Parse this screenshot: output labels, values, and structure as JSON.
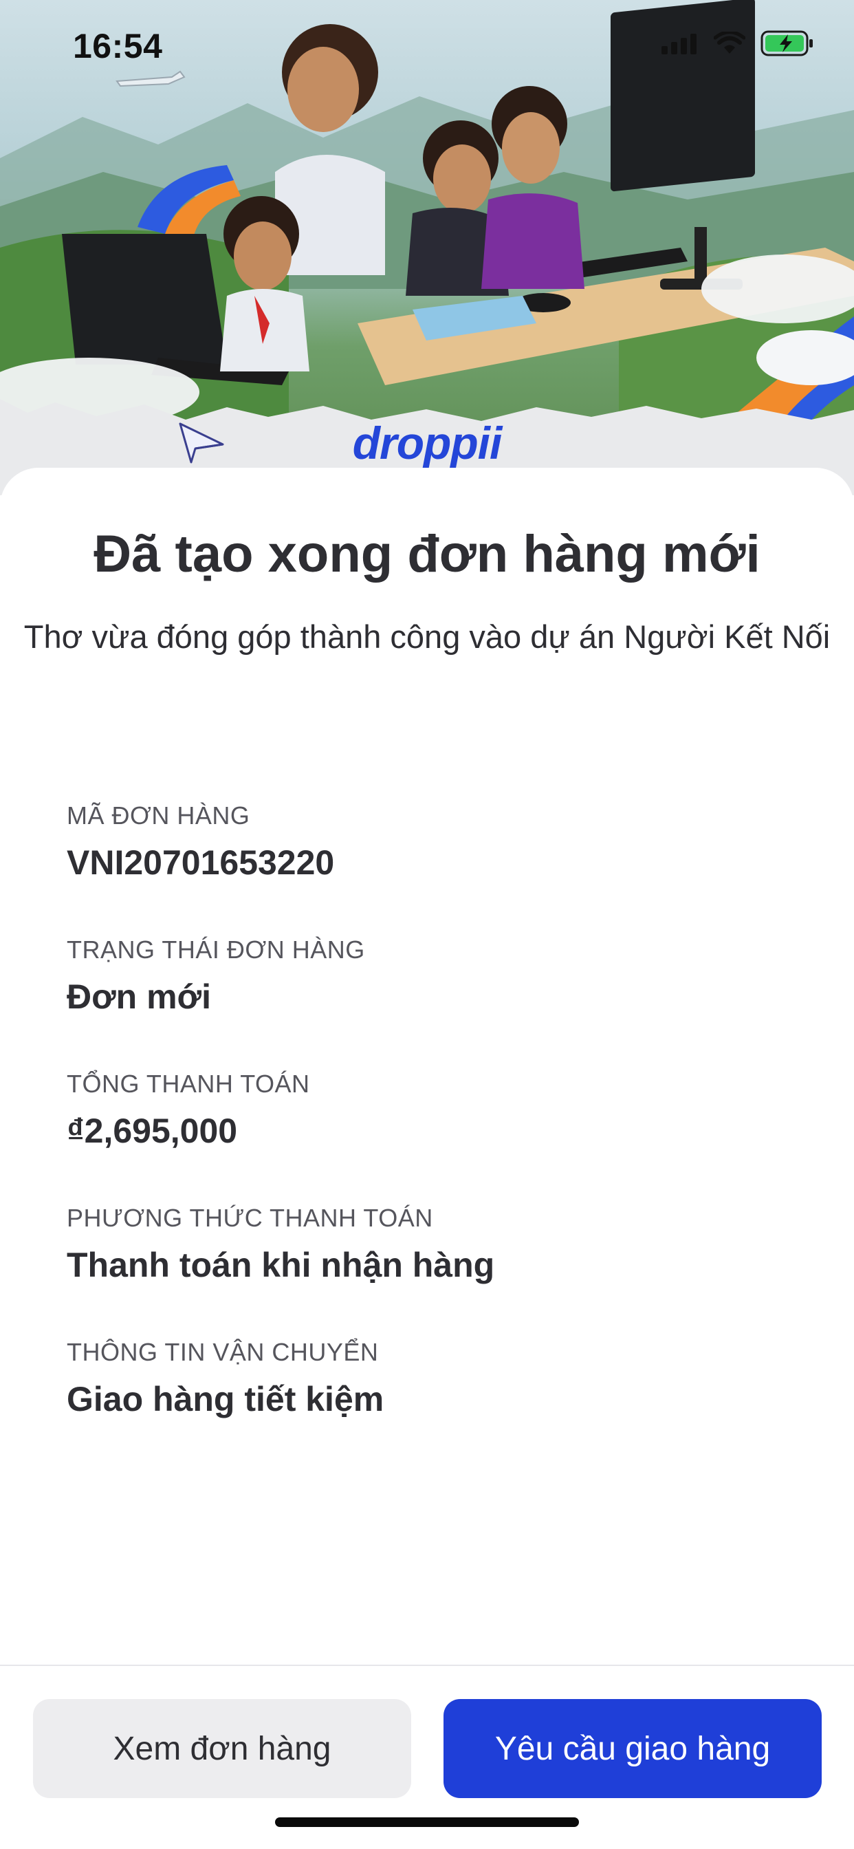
{
  "status_bar": {
    "time": "16:54"
  },
  "hero": {
    "logo_text": "droppii"
  },
  "header": {
    "title": "Đã tạo xong đơn hàng mới",
    "subtitle": "Thơ vừa đóng góp thành công vào dự án Người Kết Nối"
  },
  "order_info": [
    {
      "label": "MÃ ĐƠN HÀNG",
      "value": "VNI20701653220"
    },
    {
      "label": "TRẠNG THÁI ĐƠN HÀNG",
      "value": "Đơn mới"
    },
    {
      "label": "TỔNG THANH TOÁN",
      "value": "₫2,695,000"
    },
    {
      "label": "PHƯƠNG THỨC THANH TOÁN",
      "value": "Thanh toán khi nhận hàng"
    },
    {
      "label": "THÔNG TIN VẬN CHUYỂN",
      "value": "Giao hàng tiết kiệm"
    }
  ],
  "actions": {
    "view_order": "Xem đơn hàng",
    "request_delivery": "Yêu cầu giao hàng"
  },
  "colors": {
    "primary": "#1f3fd8",
    "secondary_bg": "#ededef",
    "text": "#2e2e33",
    "label": "#55555c"
  },
  "icons": [
    "signal-icon",
    "wifi-icon",
    "battery-charging-icon",
    "paper-plane-icon"
  ]
}
